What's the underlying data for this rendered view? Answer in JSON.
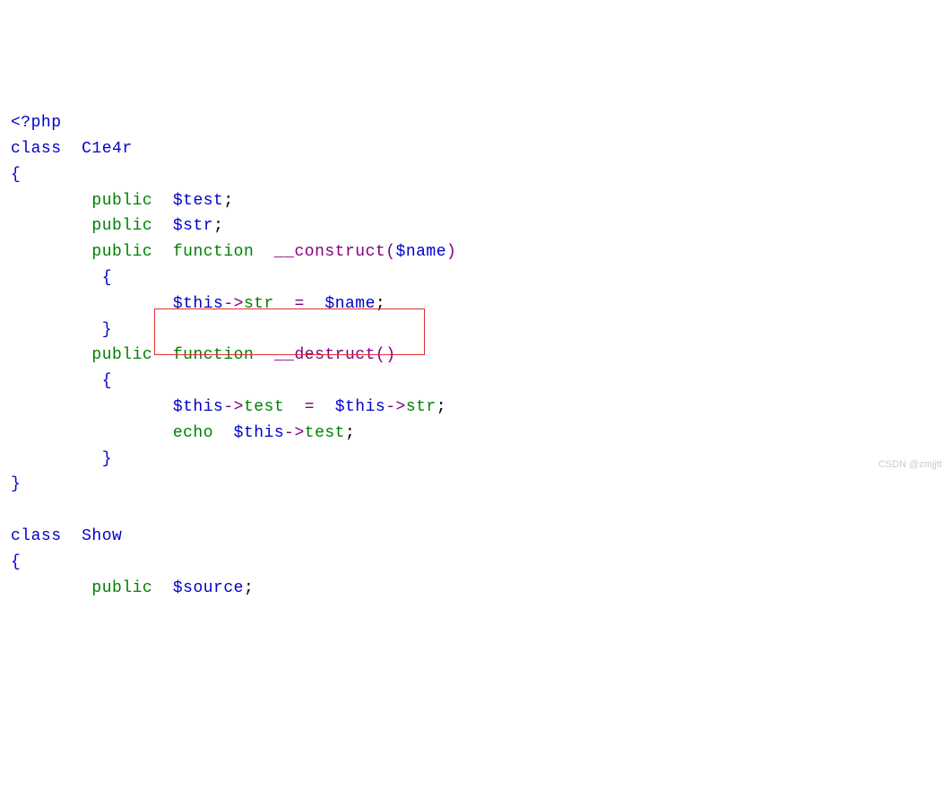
{
  "code": {
    "l1_open": "<?php",
    "l2_class": "class",
    "l2_name": "C1e4r",
    "l4_public": "public",
    "l4_var": "$test",
    "l5_public": "public",
    "l5_var": "$str",
    "l6_public": "public",
    "l6_func_kw": "function",
    "l6_func_name": "__construct",
    "l6_arg": "$name",
    "l8_this": "$this",
    "l8_arrow": "->",
    "l8_member": "str",
    "l8_eq": "=",
    "l8_rhs": "$name",
    "l10_public": "public",
    "l10_func_kw": "function",
    "l10_func_name": "__destruct",
    "l12_this": "$this",
    "l12_arrow": "->",
    "l12_member": "test",
    "l12_eq": "=",
    "l12_rhs_this": "$this",
    "l12_rhs_arrow": "->",
    "l12_rhs_member": "str",
    "l13_echo": "echo",
    "l13_this": "$this",
    "l13_arrow": "->",
    "l13_member": "test",
    "l17_class": "class",
    "l17_name": "Show",
    "l19_public": "public",
    "l19_var": "$source"
  },
  "watermark": "CSDN @zmjjtt"
}
